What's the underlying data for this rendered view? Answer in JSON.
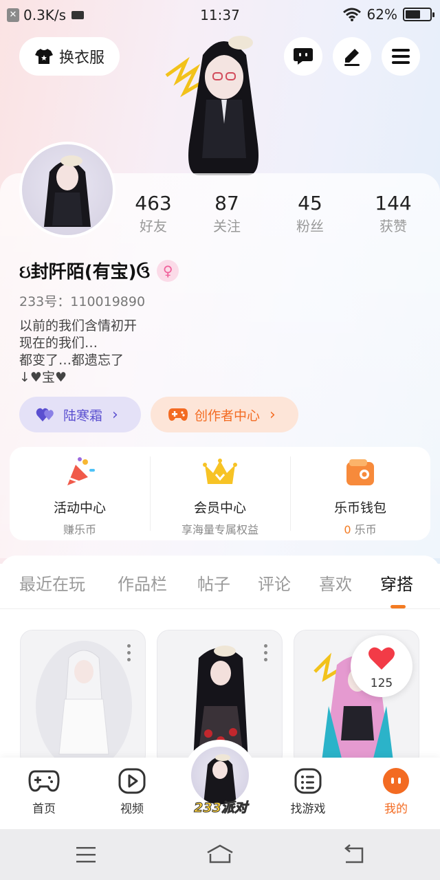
{
  "status_bar": {
    "net_speed": "0.3K/s",
    "time": "11:37",
    "battery": "62%",
    "battery_level": 0.62
  },
  "top_actions": {
    "outfit_label": "换衣服"
  },
  "profile": {
    "stats": [
      {
        "value": "463",
        "label": "好友"
      },
      {
        "value": "87",
        "label": "关注"
      },
      {
        "value": "45",
        "label": "粉丝"
      },
      {
        "value": "144",
        "label": "获赞"
      }
    ],
    "username": "ઇ封阡陌(有宝)ઉ",
    "gender_symbol": "♀",
    "uid": "233号：110019890",
    "bio_lines": [
      "以前的我们含情初开",
      "现在的我们…",
      "都变了…都遗忘了",
      "↓♥宝♥"
    ],
    "pill_purple": "陆寒霜",
    "pill_orange": "创作者中心"
  },
  "features": [
    {
      "title": "活动中心",
      "sub": "赚乐币"
    },
    {
      "title": "会员中心",
      "sub": "享海量专属权益"
    },
    {
      "title": "乐币钱包",
      "sub_num": "0",
      "sub": "乐币"
    }
  ],
  "tabs": [
    "最近在玩",
    "作品栏",
    "帖子",
    "评论",
    "喜欢",
    "穿搭"
  ],
  "active_tab": "穿搭",
  "like_count": "125",
  "bottom_nav": {
    "items": [
      "首页",
      "视频",
      "找游戏",
      "我的"
    ],
    "center_logo": "233派对",
    "active": "我的"
  },
  "colors": {
    "accent": "#f36b22",
    "purple": "#5a4fd0"
  }
}
